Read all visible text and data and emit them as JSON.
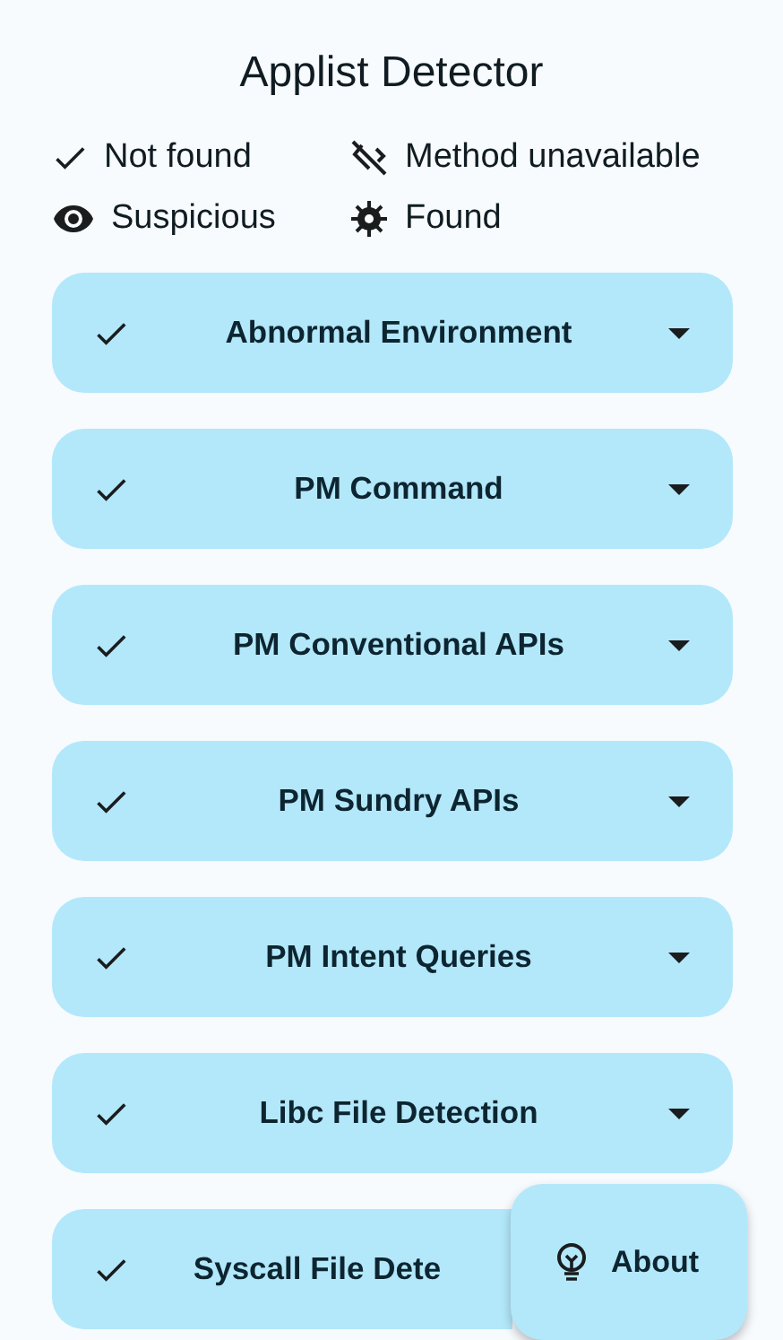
{
  "title": "Applist Detector",
  "legend": [
    {
      "kind": "not_found",
      "label": "Not found"
    },
    {
      "kind": "unavailable",
      "label": "Method unavailable"
    },
    {
      "kind": "suspicious",
      "label": "Suspicious"
    },
    {
      "kind": "found",
      "label": "Found"
    }
  ],
  "checks": [
    {
      "name": "Abnormal Environment",
      "kind": "not_found",
      "expanded": false
    },
    {
      "name": "PM Command",
      "kind": "not_found",
      "expanded": false
    },
    {
      "name": "PM Conventional APIs",
      "kind": "not_found",
      "expanded": false
    },
    {
      "name": "PM Sundry APIs",
      "kind": "not_found",
      "expanded": false
    },
    {
      "name": "PM Intent Queries",
      "kind": "not_found",
      "expanded": false
    },
    {
      "name": "Libc File Detection",
      "kind": "not_found",
      "expanded": false
    },
    {
      "name": "Syscall File Dete",
      "kind": "not_found",
      "covered": true
    }
  ],
  "fab": {
    "label": "About"
  }
}
